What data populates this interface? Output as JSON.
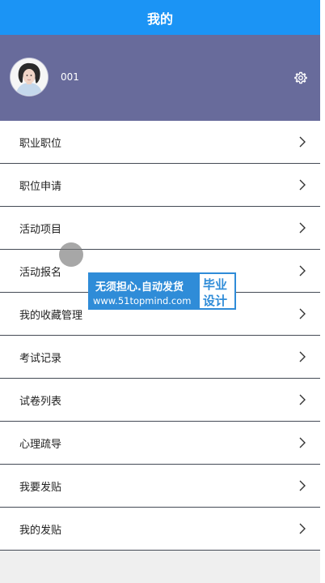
{
  "topbar": {
    "title": "我的"
  },
  "profile": {
    "username": "001"
  },
  "menu": [
    {
      "label": "职业职位"
    },
    {
      "label": "职位申请"
    },
    {
      "label": "活动项目"
    },
    {
      "label": "活动报名"
    },
    {
      "label": "我的收藏管理"
    },
    {
      "label": "考试记录"
    },
    {
      "label": "试卷列表"
    },
    {
      "label": "心理疏导"
    },
    {
      "label": "我要发贴"
    },
    {
      "label": "我的发贴"
    }
  ],
  "watermark": {
    "line1": "无须担心.自动发货",
    "line2": "www.51topmind.com",
    "right_top": "毕业",
    "right_bottom": "设计"
  },
  "colors": {
    "topbar": "#1b94f5",
    "profile_bg": "#686b9b",
    "divider": "#444a55",
    "watermark_blue": "#2f8cd8"
  },
  "icons": {
    "avatar": "avatar-photo",
    "settings": "gear-icon",
    "chevron": "chevron-right-icon"
  }
}
